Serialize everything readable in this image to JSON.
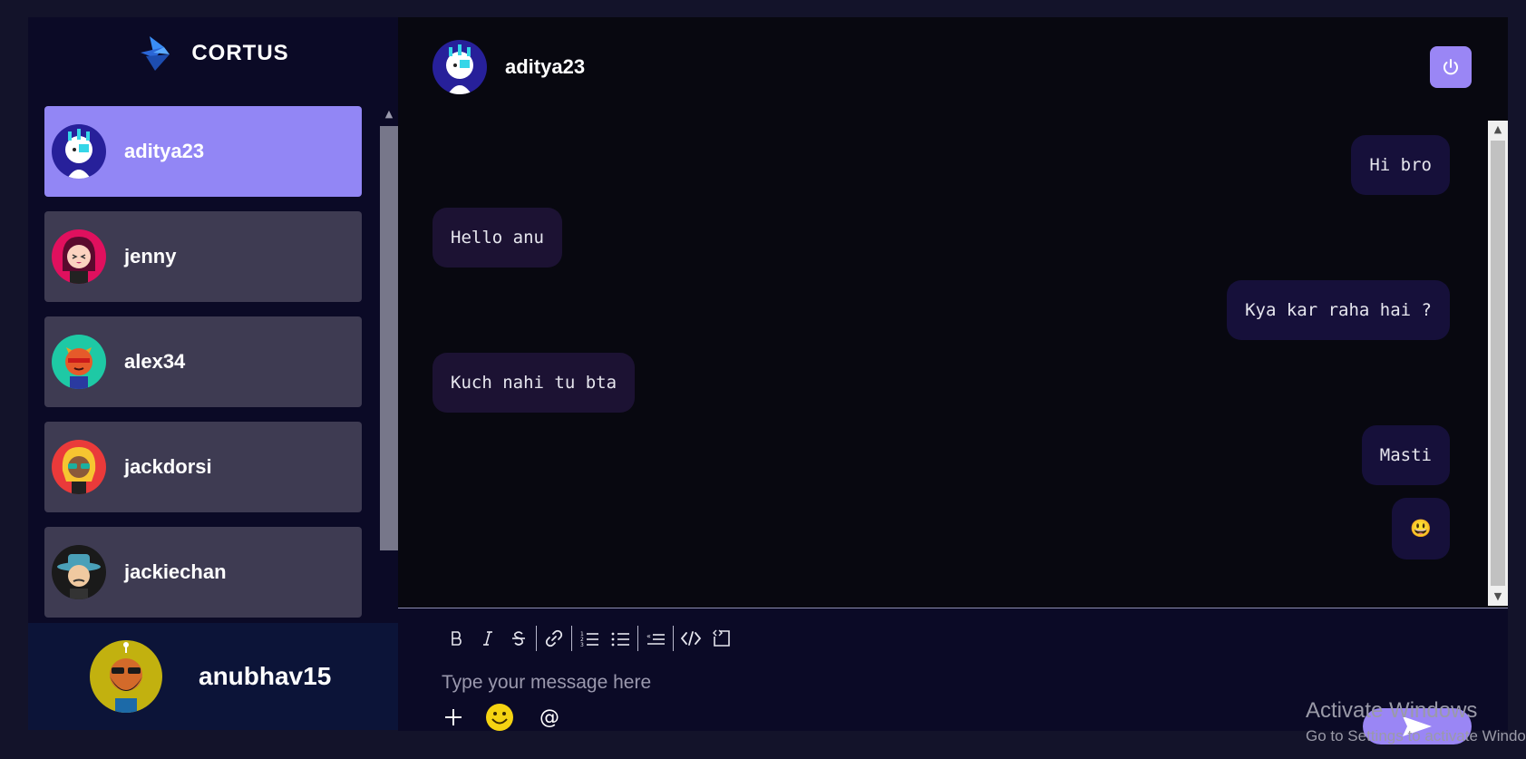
{
  "app": {
    "brand": "CORTUS"
  },
  "contacts": [
    {
      "name": "aditya23",
      "avatar": "robot-avatar",
      "active": true
    },
    {
      "name": "jenny",
      "avatar": "girl-avatar",
      "active": false
    },
    {
      "name": "alex34",
      "avatar": "devil-avatar",
      "active": false
    },
    {
      "name": "jackdorsi",
      "avatar": "blonde-avatar",
      "active": false
    },
    {
      "name": "jackiechan",
      "avatar": "hat-avatar",
      "active": false
    }
  ],
  "current_user": {
    "name": "anubhav15",
    "avatar": "bearded-avatar"
  },
  "chat": {
    "recipient": "aditya23",
    "messages": [
      {
        "text": "Hi bro",
        "direction": "out"
      },
      {
        "text": "Hello anu",
        "direction": "in"
      },
      {
        "text": "Kya kar raha hai ?",
        "direction": "out"
      },
      {
        "text": "Kuch nahi tu bta",
        "direction": "in"
      },
      {
        "text": "Masti",
        "direction": "out"
      },
      {
        "text": "😃",
        "direction": "out"
      }
    ]
  },
  "composer": {
    "placeholder": "Type your message here",
    "toolbar": [
      "bold-icon",
      "italic-icon",
      "strikethrough-icon",
      "link-icon",
      "ordered-list-icon",
      "bullet-list-icon",
      "blockquote-icon",
      "code-icon",
      "code-block-icon"
    ],
    "tools": [
      "plus-icon",
      "emoji-icon",
      "mention-icon"
    ],
    "mention_symbol": "@"
  },
  "watermark": {
    "line1": "Activate Windows",
    "line2": "Go to Settings to activate Windows."
  },
  "colors": {
    "accent": "#9286f5",
    "sidebar_bg": "#0b0a26",
    "chat_bg": "#080810",
    "contact_bg": "#3e3b52"
  }
}
